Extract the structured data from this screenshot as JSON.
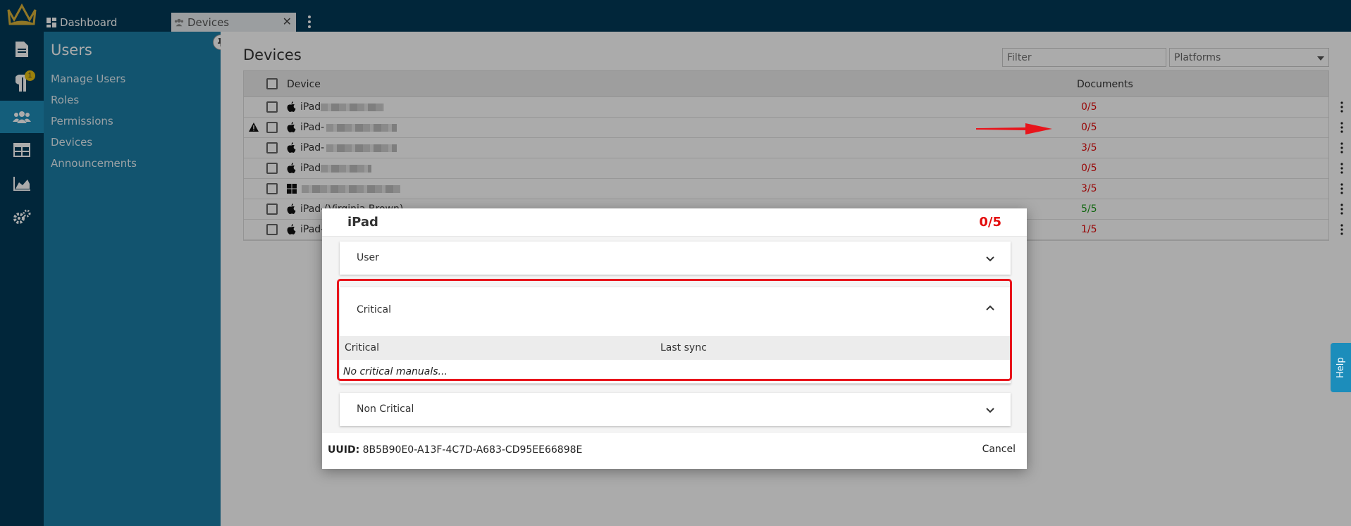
{
  "topbar": {
    "tabs": [
      {
        "label": "Dashboard"
      },
      {
        "label": "Devices",
        "close": "✕"
      }
    ]
  },
  "rail": {
    "notification_count": "1"
  },
  "sidebar": {
    "title": "Users",
    "items": [
      {
        "label": "Manage Users"
      },
      {
        "label": "Roles"
      },
      {
        "label": "Permissions"
      },
      {
        "label": "Devices"
      },
      {
        "label": "Announcements"
      }
    ]
  },
  "main": {
    "title": "Devices",
    "filter_placeholder": "Filter",
    "platforms_label": "Platforms",
    "table": {
      "columns": [
        "Device",
        "Documents"
      ],
      "rows": [
        {
          "name": "iPad",
          "platform": "apple",
          "documents": "0/5",
          "status": "red"
        },
        {
          "name": "iPad-",
          "platform": "apple",
          "documents": "0/5",
          "status": "red",
          "warning": true
        },
        {
          "name": "iPad-",
          "platform": "apple",
          "documents": "3/5",
          "status": "red"
        },
        {
          "name": "iPad",
          "platform": "apple",
          "documents": "0/5",
          "status": "red"
        },
        {
          "name": "",
          "platform": "windows",
          "documents": "3/5",
          "status": "red"
        },
        {
          "name": "iPad-(Virginia Brown)",
          "platform": "apple",
          "documents": "5/5",
          "status": "green"
        },
        {
          "name": "iPad-",
          "platform": "apple",
          "documents": "1/5",
          "status": "red"
        }
      ]
    }
  },
  "modal": {
    "title": "iPad",
    "score": "0/5",
    "panels": {
      "user": "User",
      "critical": "Critical",
      "non_critical": "Non Critical"
    },
    "critical_table": {
      "columns": [
        "Critical",
        "Last sync"
      ],
      "empty_message": "No critical manuals..."
    },
    "uuid_label": "UUID:",
    "uuid_value": "8B5B90E0-A13F-4C7D-A683-CD95EE66898E",
    "cancel_label": "Cancel"
  },
  "help_label": "Help",
  "colors": {
    "nav_dark": "#023a57",
    "sidebar": "#1b7ea6",
    "status_red": "#e30b0b",
    "status_green": "#1a9a1a",
    "highlight": "#e8141b"
  }
}
